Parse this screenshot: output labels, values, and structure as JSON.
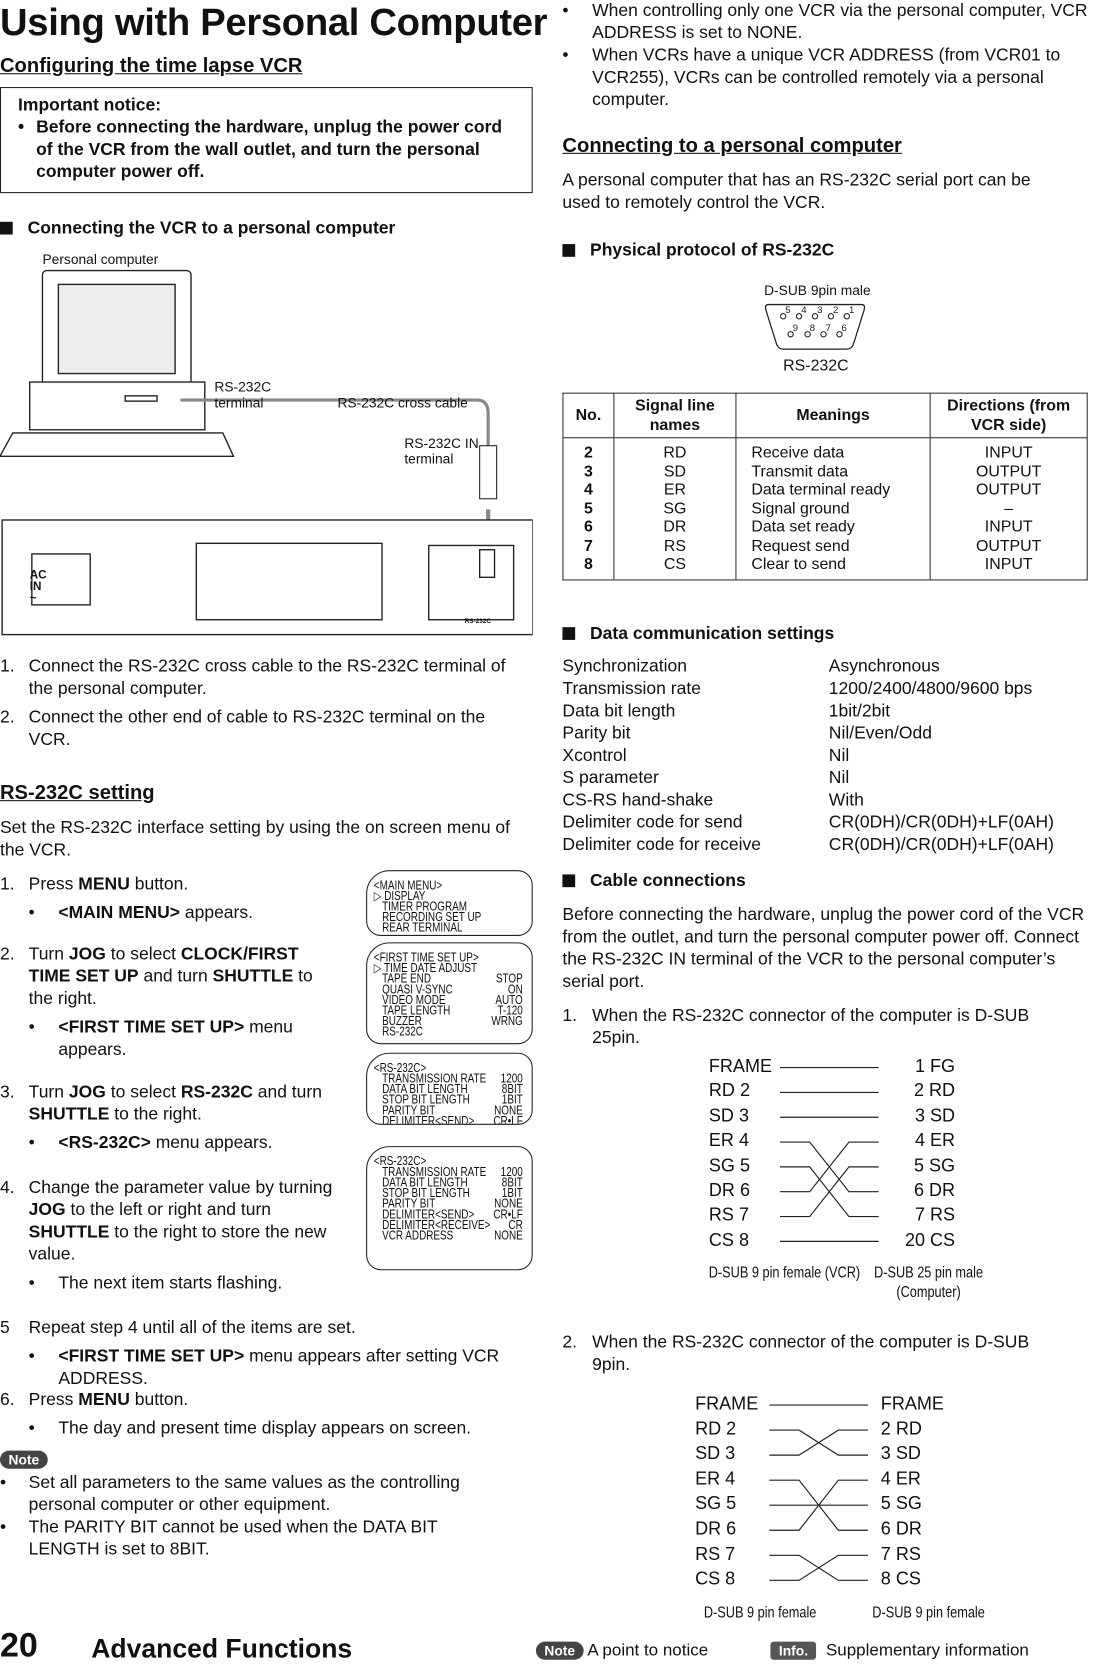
{
  "title": "Using with Personal Computer",
  "left": {
    "config_heading": "Configuring the time lapse VCR",
    "notice_title": "Important notice:",
    "notice_text": "Before connecting the hardware, unplug the power cord of the VCR from the wall outlet, and turn the personal computer power off.",
    "connect_heading": "Connecting the VCR to a personal computer",
    "diagram": {
      "pc_label": "Personal computer",
      "terminal_label": "RS-232C terminal",
      "cable_label": "RS-232C cross cable",
      "in_terminal_label": "RS-232C IN terminal",
      "ac_in": "AC IN ~",
      "rs232c_panel": "RS-232C"
    },
    "connect_steps": [
      "Connect the RS-232C cross cable to the RS-232C terminal of the personal computer.",
      "Connect the other end of cable to RS-232C terminal on the VCR."
    ],
    "setting_heading": "RS-232C setting",
    "setting_intro": "Set the RS-232C interface setting by using the on screen menu of the VCR.",
    "steps": [
      {
        "n": "1.",
        "pre": "Press ",
        "b1": "MENU",
        "post": " button.",
        "bullet_b": "<MAIN MENU>",
        "bullet": " appears."
      },
      {
        "n": "2.",
        "pre": "Turn ",
        "b1": "JOG",
        "mid": " to select ",
        "b2": "CLOCK/FIRST TIME SET UP",
        "mid2": " and turn ",
        "b3": "SHUTTLE",
        "post": " to the right.",
        "bullet_b": "<FIRST TIME SET UP>",
        "bullet": " menu appears."
      },
      {
        "n": "3.",
        "pre": "Turn ",
        "b1": "JOG",
        "mid": " to select ",
        "b2": "RS-232C",
        "mid2": " and turn ",
        "b3": "SHUTTLE",
        "post": " to the right.",
        "bullet_b": "<RS-232C>",
        "bullet": " menu appears."
      },
      {
        "n": "4.",
        "pre": "Change the parameter value by turning ",
        "b1": "JOG",
        "mid": " to the left or right and turn ",
        "b2": "SHUTTLE",
        "post": " to the right to store the new value.",
        "bullet": "The next item starts flashing."
      },
      {
        "n": "5",
        "text": "Repeat step 4 until all of the items are set.",
        "bullet_b": "<FIRST TIME SET UP>",
        "bullet": " menu appears after setting VCR ADDRESS."
      },
      {
        "n": "6.",
        "pre": "Press ",
        "b1": "MENU",
        "post": " button.",
        "bullet": "The day and present time display appears on screen."
      }
    ],
    "note_badge": "Note",
    "notes": [
      "Set all parameters to the same values as the controlling personal computer or other equipment.",
      "The PARITY BIT cannot be used when the DATA BIT LENGTH is set to 8BIT."
    ],
    "menus": [
      {
        "title": "<MAIN MENU>",
        "rows": [
          [
            "DISPLAY",
            ""
          ],
          [
            "TIMER PROGRAM",
            ""
          ],
          [
            "RECORDING SET UP",
            ""
          ],
          [
            "REAR TERMINAL",
            ""
          ]
        ]
      },
      {
        "title": "<FIRST TIME SET UP>",
        "rows": [
          [
            "TIME DATE ADJUST",
            ""
          ],
          [
            "TAPE END",
            "STOP"
          ],
          [
            "QUASI V-SYNC",
            "ON"
          ],
          [
            "VIDEO MODE",
            "AUTO"
          ],
          [
            "TAPE LENGTH",
            "T-120"
          ],
          [
            "BUZZER",
            "WRNG"
          ],
          [
            "RS-232C",
            ""
          ]
        ]
      },
      {
        "title": "<RS-232C>",
        "rows": [
          [
            "TRANSMISSION RATE",
            "1200"
          ],
          [
            "DATA BIT LENGTH",
            "8BIT"
          ],
          [
            "STOP BIT LENGTH",
            "1BIT"
          ],
          [
            "PARITY BIT",
            "NONE"
          ],
          [
            "DELIMITER<SEND>",
            "CR•LF"
          ]
        ]
      },
      {
        "title": "<RS-232C>",
        "rows": [
          [
            "TRANSMISSION RATE",
            "1200"
          ],
          [
            "DATA BIT LENGTH",
            "8BIT"
          ],
          [
            "STOP BIT LENGTH",
            "1BIT"
          ],
          [
            "PARITY BIT",
            "NONE"
          ],
          [
            "DELIMITER<SEND>",
            "CR•LF"
          ],
          [
            "DELIMITER<RECEIVE>",
            "CR"
          ],
          [
            "VCR ADDRESS",
            "NONE"
          ]
        ]
      }
    ]
  },
  "right": {
    "bullets": [
      "When controlling only one VCR via the personal computer, VCR ADDRESS is set to NONE.",
      "When VCRs have a unique VCR ADDRESS (from VCR01 to VCR255), VCRs can be controlled remotely via a personal computer."
    ],
    "connecting_heading": "Connecting to a personal computer",
    "connecting_text": "A personal computer that has an RS-232C serial port can be used to remotely control the VCR.",
    "protocol_heading": "Physical protocol of RS-232C",
    "dsub_label": "D-SUB 9pin male",
    "dsub_caption": "RS-232C",
    "dsub_pins_top": [
      "5",
      "4",
      "3",
      "2",
      "1"
    ],
    "dsub_pins_bottom": [
      "9",
      "8",
      "7",
      "6"
    ],
    "table": {
      "headers": [
        "No.",
        "Signal line names",
        "Meanings",
        "Directions (from VCR side)"
      ],
      "rows": [
        [
          "2",
          "RD",
          "Receive data",
          "INPUT"
        ],
        [
          "3",
          "SD",
          "Transmit data",
          "OUTPUT"
        ],
        [
          "4",
          "ER",
          "Data terminal ready",
          "OUTPUT"
        ],
        [
          "5",
          "SG",
          "Signal ground",
          "–"
        ],
        [
          "6",
          "DR",
          "Data set ready",
          "INPUT"
        ],
        [
          "7",
          "RS",
          "Request send",
          "OUTPUT"
        ],
        [
          "8",
          "CS",
          "Clear to send",
          "INPUT"
        ]
      ]
    },
    "comm_heading": "Data communication settings",
    "settings": [
      [
        "Synchronization",
        "Asynchronous"
      ],
      [
        "Transmission rate",
        "1200/2400/4800/9600 bps"
      ],
      [
        "Data bit length",
        "1bit/2bit"
      ],
      [
        "Parity bit",
        "Nil/Even/Odd"
      ],
      [
        "Xcontrol",
        "Nil"
      ],
      [
        "S parameter",
        "Nil"
      ],
      [
        "CS-RS hand-shake",
        "With"
      ],
      [
        "Delimiter code for send",
        "CR(0DH)/CR(0DH)+LF(0AH)"
      ],
      [
        "Delimiter code for receive",
        "CR(0DH)/CR(0DH)+LF(0AH)"
      ]
    ],
    "cable_heading": "Cable connections",
    "cable_text": "Before connecting the hardware, unplug the power cord of the VCR from the outlet, and turn the personal computer power off. Connect the RS-232C IN terminal of the VCR to the personal computer’s serial port.",
    "cases": [
      {
        "n": "1.",
        "text": "When the RS-232C connector of the computer is D-SUB 25pin.",
        "left": [
          "FRAME",
          "RD 2",
          "SD 3",
          "ER 4",
          "SG 5",
          "DR 6",
          "RS 7",
          "CS 8"
        ],
        "right": [
          "1 FG",
          "2 RD",
          "3 SD",
          "4 ER",
          "5 SG",
          "6 DR",
          "7 RS",
          "20 CS"
        ],
        "left_caption": "D-SUB 9 pin female (VCR)",
        "right_caption": "D-SUB 25 pin male (Computer)"
      },
      {
        "n": "2.",
        "text": "When the RS-232C connector of the computer is D-SUB 9pin.",
        "left": [
          "FRAME",
          "RD 2",
          "SD 3",
          "ER 4",
          "SG 5",
          "DR 6",
          "RS 7",
          "CS 8"
        ],
        "right": [
          "FRAME",
          "2 RD",
          "3 SD",
          "4 ER",
          "5 SG",
          "6 DR",
          "7 RS",
          "8 CS"
        ],
        "left_caption": "D-SUB 9 pin female",
        "right_caption": "D-SUB 9 pin female"
      }
    ]
  },
  "footer": {
    "page": "20",
    "section": "Advanced Functions",
    "note_badge": "Note",
    "note_text": "A point to notice",
    "info_badge": "Info.",
    "info_text": "Supplementary information"
  }
}
